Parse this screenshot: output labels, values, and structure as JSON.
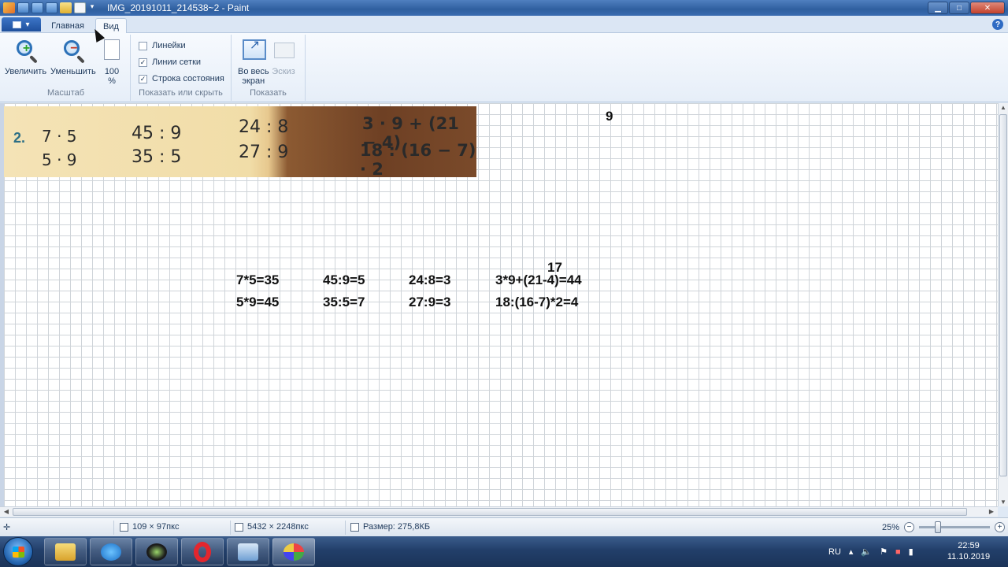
{
  "window": {
    "title": "IMG_20191011_214538~2 - Paint",
    "minimize": "▁",
    "maximize": "□",
    "close": "✕"
  },
  "tabs": {
    "menu": "▾",
    "home": "Главная",
    "view": "Вид",
    "help": "?"
  },
  "ribbon": {
    "zoom_group": {
      "label": "Масштаб",
      "zoom_in": "Увеличить",
      "zoom_out": "Уменьшить",
      "hundred_line1": "100",
      "hundred_line2": "%"
    },
    "show_group": {
      "label": "Показать или скрыть",
      "rulers": {
        "label": "Линейки",
        "checked": false
      },
      "gridlines": {
        "label": "Линии сетки",
        "checked": true
      },
      "statusbar": {
        "label": "Строка состояния",
        "checked": true
      }
    },
    "display_group": {
      "label": "Показать",
      "fullscreen_line1": "Во весь",
      "fullscreen_line2": "экран",
      "thumbnail": "Эскиз"
    }
  },
  "photo": {
    "number": "2.",
    "items": [
      "7 · 5",
      "5 · 9",
      "45 : 9",
      "35 : 5",
      "24 : 8",
      "27 : 9",
      "3 · 9 + (21 − 4)",
      "18 : (16 − 7) · 2"
    ]
  },
  "annotations": {
    "top_nine": "9",
    "seventeen": "17",
    "row1": [
      "7*5=35",
      "45:9=5",
      "24:8=3",
      "3*9+(21-4)=44"
    ],
    "row2": [
      "5*9=45",
      "35:5=7",
      "27:9=3",
      "18:(16-7)*2=4"
    ]
  },
  "statusbar": {
    "selection": "109 × 97пкс",
    "image_size": "5432 × 2248пкс",
    "file_size": "Размер: 275,8КБ",
    "zoom": "25%"
  },
  "taskbar": {
    "language": "RU",
    "time": "22:59",
    "date": "11.10.2019"
  }
}
